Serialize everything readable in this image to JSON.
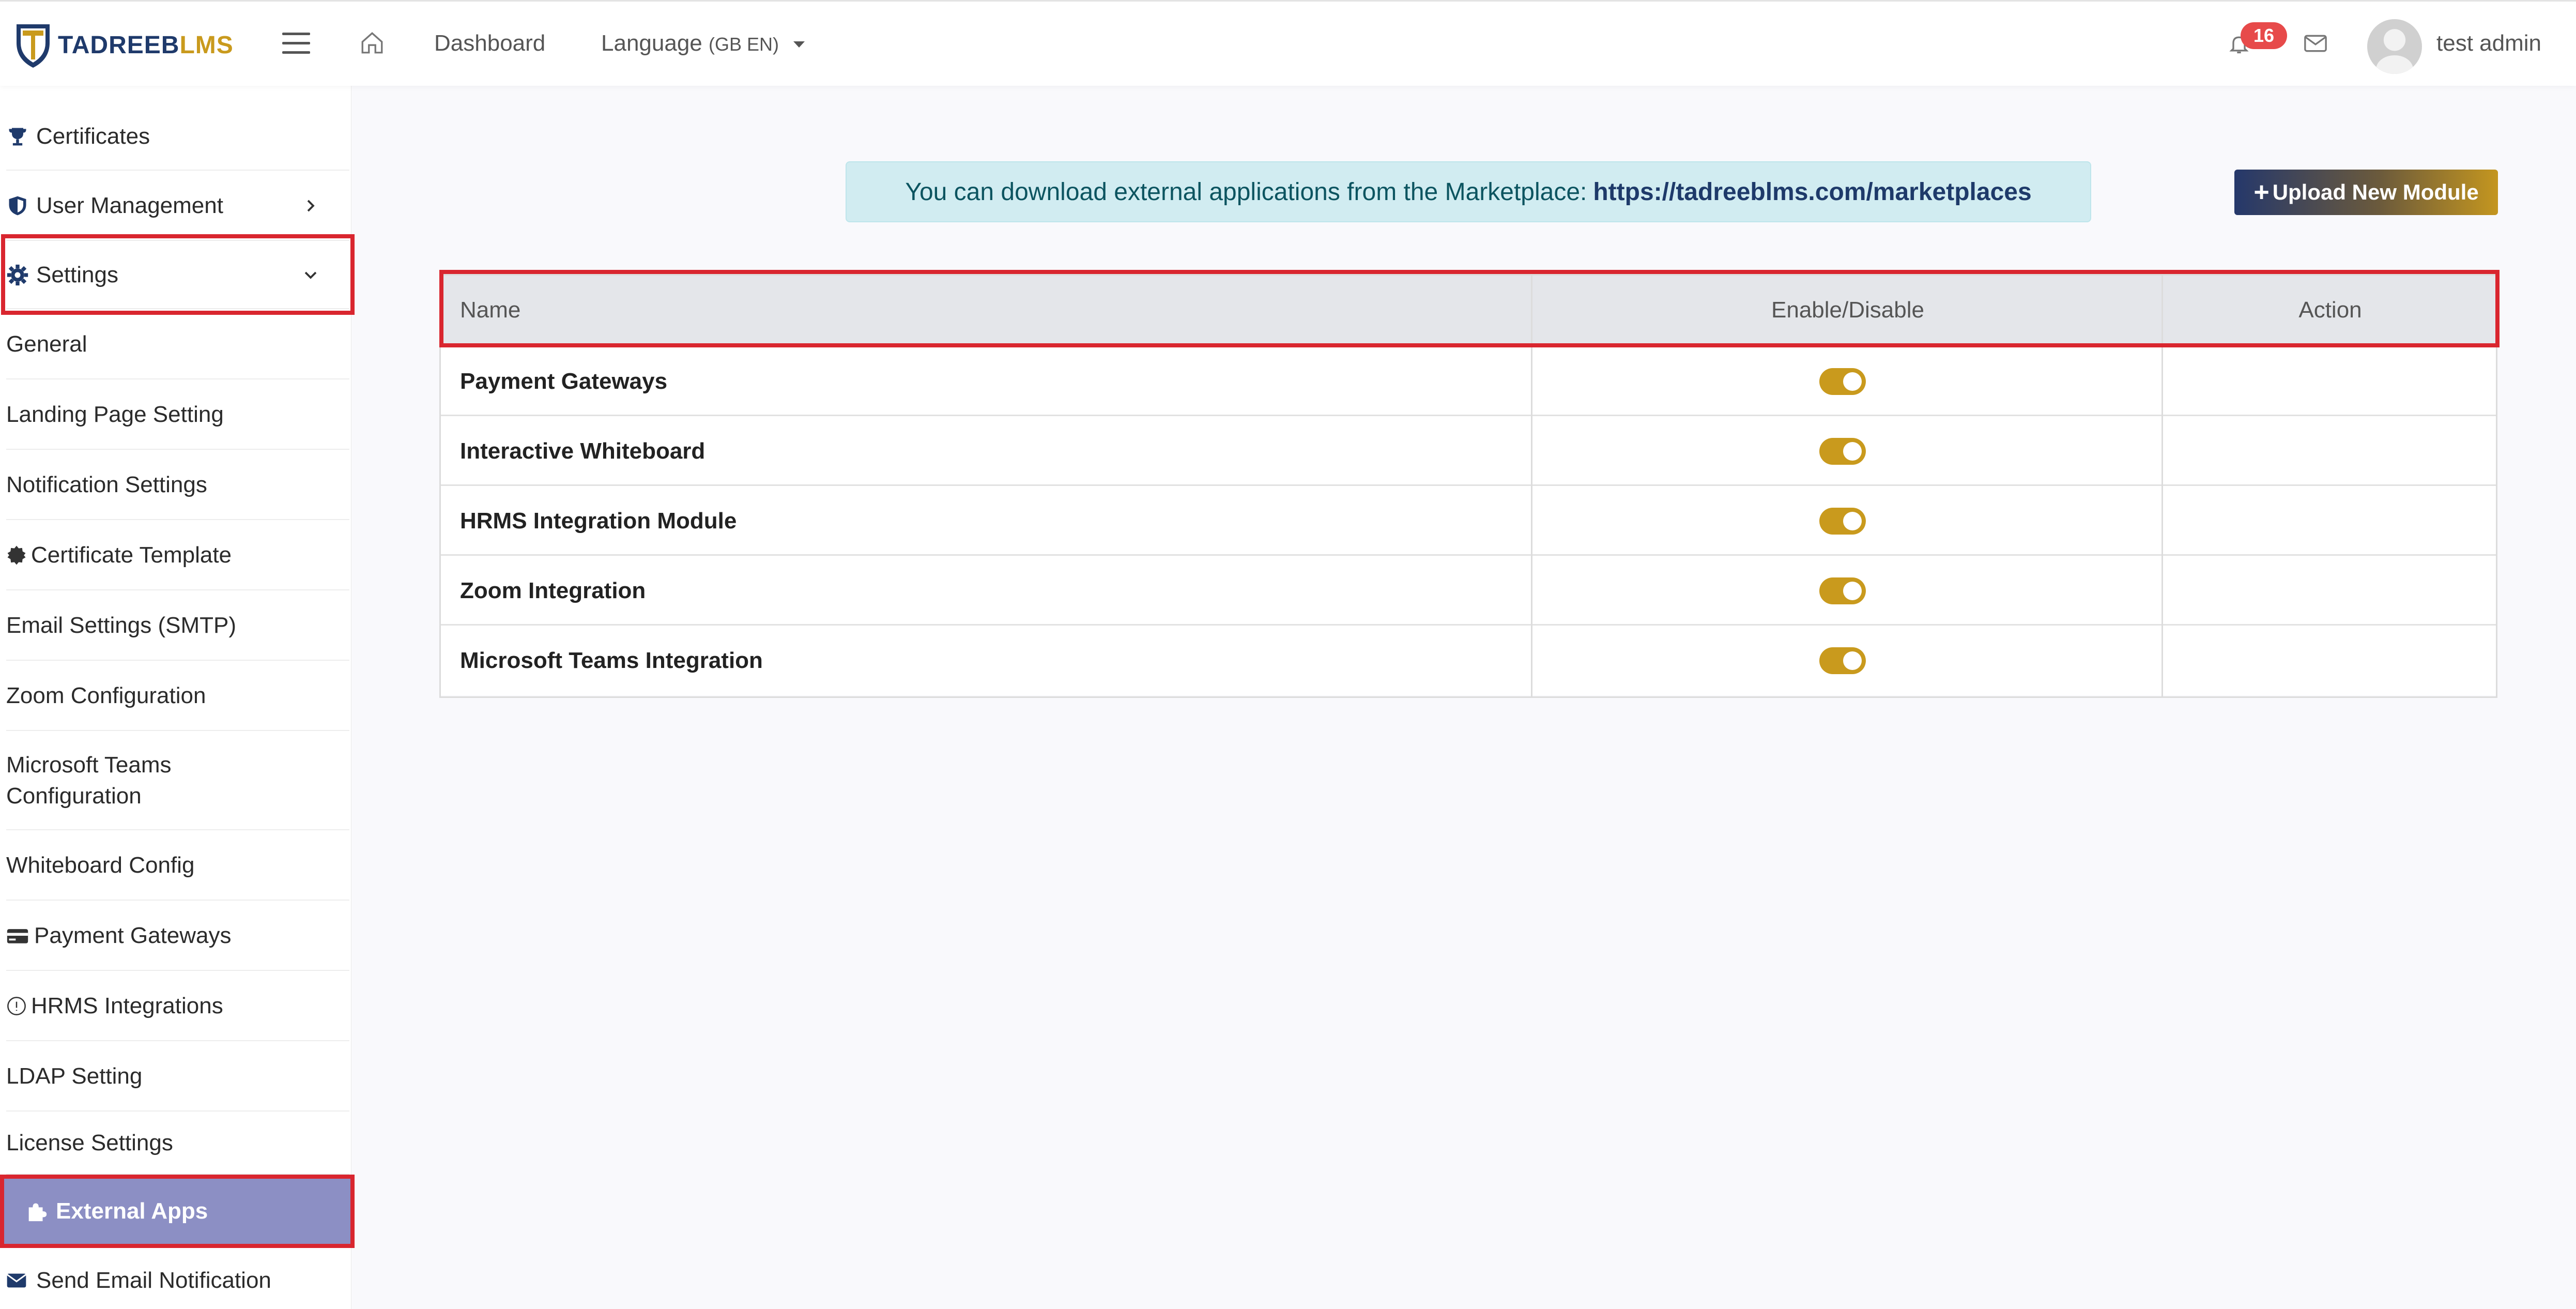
{
  "header": {
    "logo_part1": "TADREEB",
    "logo_part2": "LMS",
    "nav_dashboard": "Dashboard",
    "nav_language": "Language",
    "nav_language_code": "(GB EN)",
    "notification_count": "16",
    "user_name": "test admin",
    "icons": [
      "menu-icon",
      "home-icon",
      "bell-icon",
      "mail-icon",
      "avatar"
    ]
  },
  "sidebar": {
    "items": [
      {
        "label": "Certificates",
        "icon": "trophy-icon"
      },
      {
        "label": "User Management",
        "icon": "shield-icon"
      },
      {
        "label": "Settings",
        "icon": "gear-icon"
      },
      {
        "label": "General"
      },
      {
        "label": "Landing Page Setting"
      },
      {
        "label": "Notification Settings"
      },
      {
        "label": "Certificate Template",
        "icon": "badge-icon"
      },
      {
        "label": "Email Settings (SMTP)"
      },
      {
        "label": "Zoom Configuration"
      },
      {
        "label": "Microsoft Teams Configuration"
      },
      {
        "label": "Whiteboard Config"
      },
      {
        "label": "Payment Gateways",
        "icon": "credit-card-icon"
      },
      {
        "label": "HRMS Integrations",
        "icon": "info-icon"
      },
      {
        "label": "LDAP Setting"
      },
      {
        "label": "License Settings"
      },
      {
        "label": "External Apps",
        "icon": "puzzle-icon"
      },
      {
        "label": "Send Email Notification",
        "icon": "envelope-icon"
      }
    ],
    "active_color": "#8c8fc4"
  },
  "main": {
    "banner_text": "You can download external applications from the Marketplace:",
    "banner_link": "https://tadreeblms.com/marketplaces",
    "upload_button": "Upload New Module",
    "table": {
      "headers": [
        "Name",
        "Enable/Disable",
        "Action"
      ],
      "rows": [
        {
          "name": "Payment Gateways",
          "enabled": true
        },
        {
          "name": "Interactive Whiteboard",
          "enabled": true
        },
        {
          "name": "HRMS Integration Module",
          "enabled": true
        },
        {
          "name": "Zoom Integration",
          "enabled": true
        },
        {
          "name": "Microsoft Teams Integration",
          "enabled": true
        }
      ]
    },
    "accent_color": "#c99a1d",
    "highlight_color": "#d9262f"
  }
}
